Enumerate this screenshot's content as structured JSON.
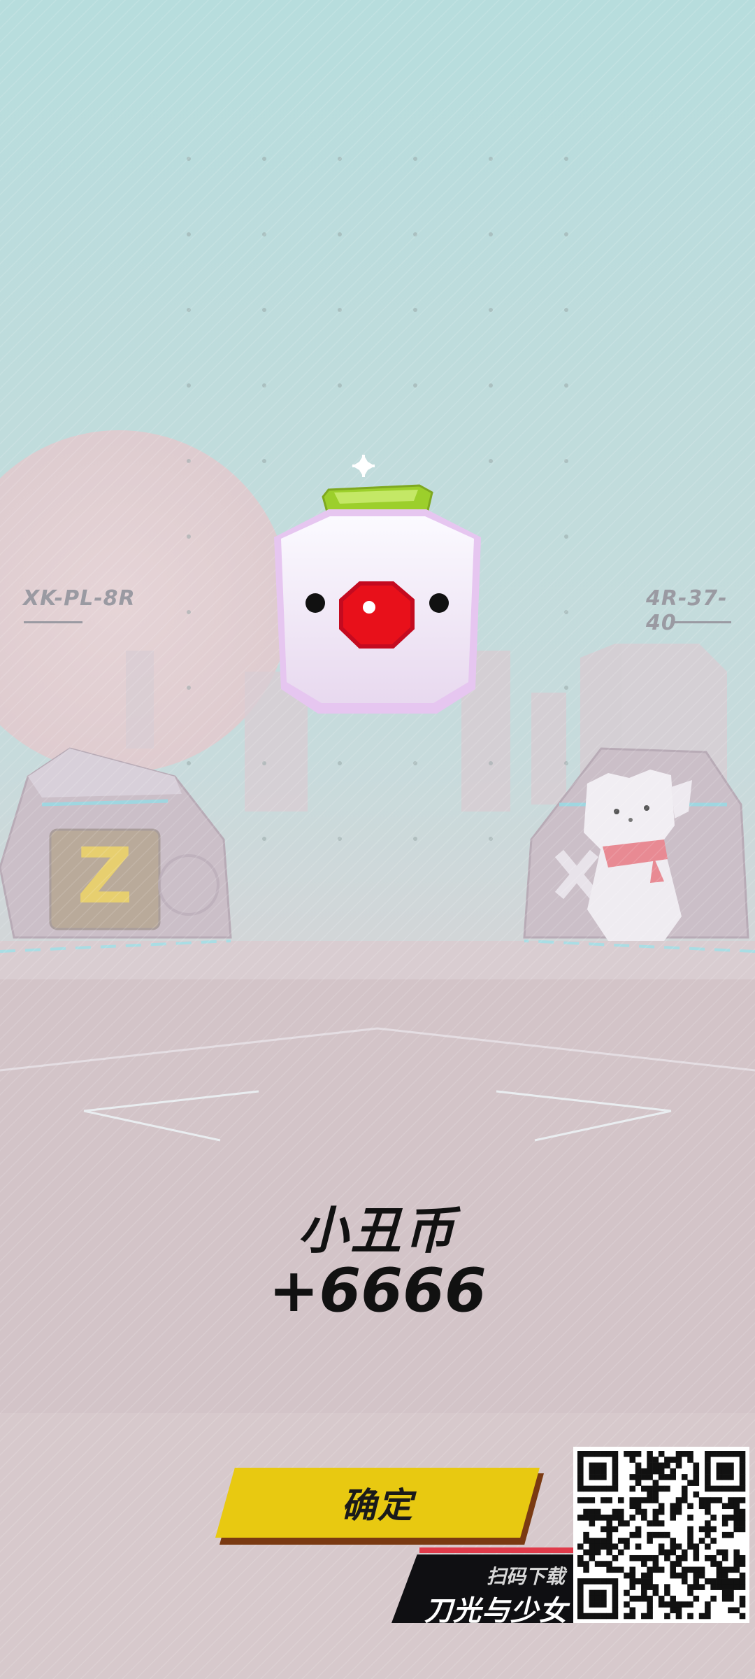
{
  "scene": {
    "left_code": "XK-PL-8R",
    "right_code": "4R-37-40"
  },
  "reward": {
    "item_name": "小丑币",
    "amount": "+6666",
    "icon": "clown-coin-icon"
  },
  "actions": {
    "confirm_label": "确定"
  },
  "promo": {
    "scan_text": "扫码下载",
    "game_title": "刀光与少女",
    "icon": "qr-code-icon"
  },
  "colors": {
    "confirm_button": "#e8c911",
    "coin_nose": "#e8101a",
    "coin_cap": "#9ccf2b",
    "background_sky": "#bde0e0",
    "background_floor": "#d5c6c9"
  }
}
